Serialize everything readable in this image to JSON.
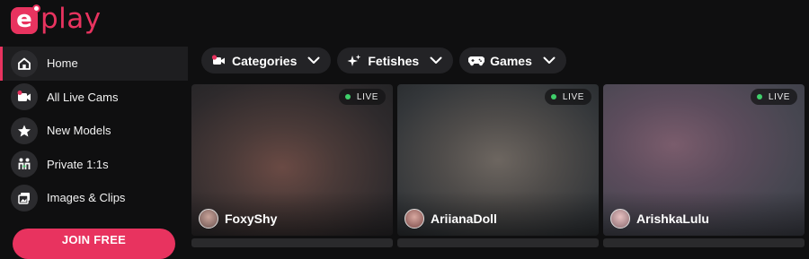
{
  "brand": {
    "logo_letter": "e",
    "wordmark": "play"
  },
  "sidebar": {
    "items": [
      {
        "label": "Home",
        "icon": "home-icon",
        "active": true
      },
      {
        "label": "All Live Cams",
        "icon": "video-camera-icon",
        "active": false
      },
      {
        "label": "New Models",
        "icon": "star-icon",
        "active": false
      },
      {
        "label": "Private 1:1s",
        "icon": "two-people-icon",
        "active": false
      },
      {
        "label": "Images & Clips",
        "icon": "images-icon",
        "active": false
      }
    ],
    "join_button": "JOIN FREE"
  },
  "filters": [
    {
      "label": "Categories",
      "icon": "camera-icon"
    },
    {
      "label": "Fetishes",
      "icon": "sparkle-icon"
    },
    {
      "label": "Games",
      "icon": "gamepad-icon"
    }
  ],
  "live_badge": "LIVE",
  "cards": [
    {
      "name": "FoxyShy"
    },
    {
      "name": "AriianaDoll"
    },
    {
      "name": "ArishkaLulu"
    }
  ],
  "colors": {
    "accent": "#e8335f",
    "background": "#0f0f10",
    "live_dot": "#3fcf6a"
  }
}
